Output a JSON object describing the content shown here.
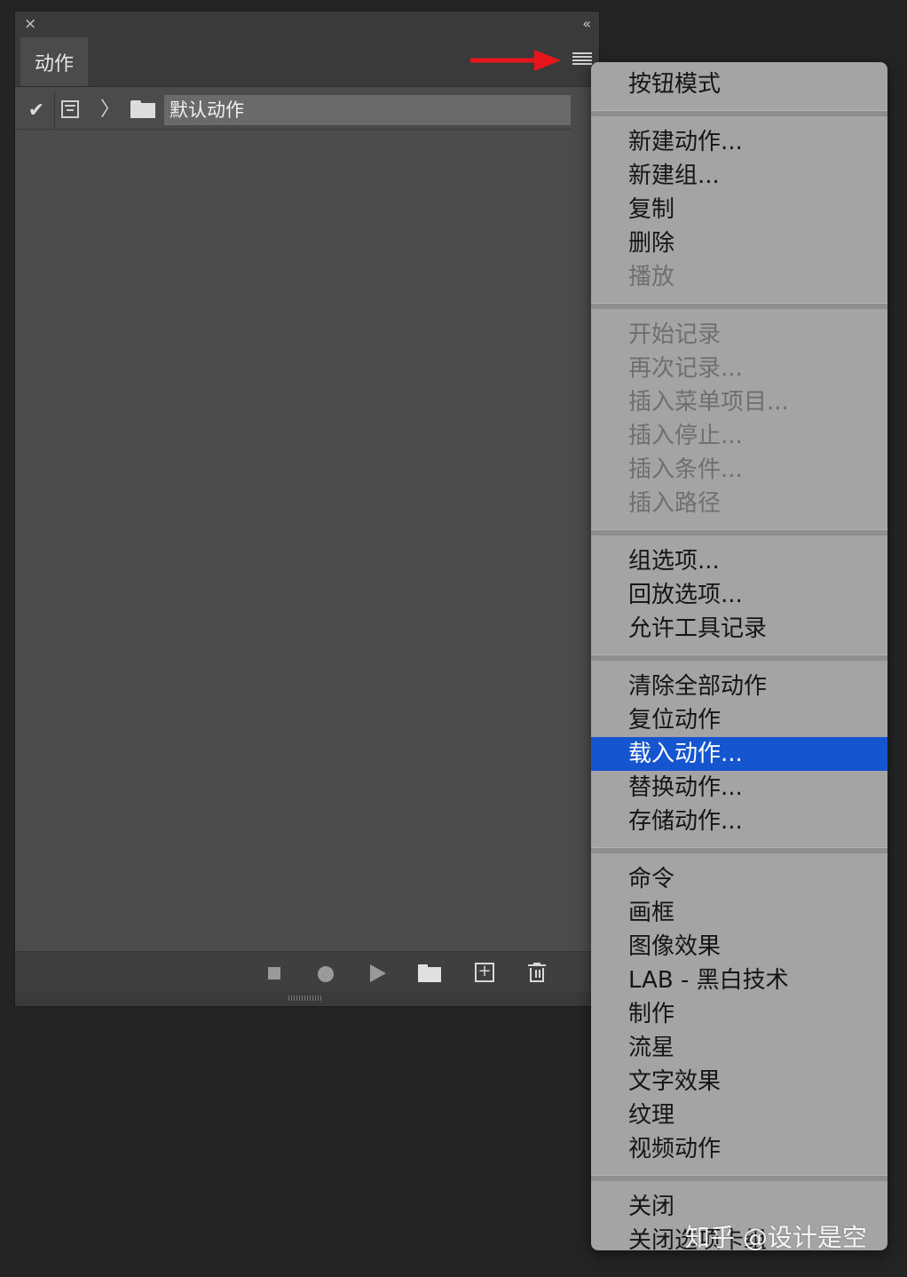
{
  "panel": {
    "tab_label": "动作",
    "close_icon": "×",
    "collapse_icon": "‹‹",
    "set": {
      "check": "✔",
      "chevron": "〉",
      "name": "默认动作"
    },
    "footer_icons": [
      "stop-icon",
      "record-icon",
      "play-icon",
      "new-set-icon",
      "new-action-icon",
      "trash-icon"
    ],
    "new_action_glyph": "+"
  },
  "arrow_color": "#e8151b",
  "menu": {
    "selected_color": "#1555d0",
    "groups": [
      {
        "items": [
          {
            "label": "按钮模式"
          }
        ]
      },
      {
        "items": [
          {
            "label": "新建动作..."
          },
          {
            "label": "新建组..."
          },
          {
            "label": "复制"
          },
          {
            "label": "删除"
          },
          {
            "label": "播放",
            "disabled": true
          }
        ]
      },
      {
        "items": [
          {
            "label": "开始记录",
            "disabled": true
          },
          {
            "label": "再次记录...",
            "disabled": true
          },
          {
            "label": "插入菜单项目...",
            "disabled": true
          },
          {
            "label": "插入停止...",
            "disabled": true
          },
          {
            "label": "插入条件...",
            "disabled": true
          },
          {
            "label": "插入路径",
            "disabled": true
          }
        ]
      },
      {
        "items": [
          {
            "label": "组选项..."
          },
          {
            "label": "回放选项..."
          },
          {
            "label": "允许工具记录"
          }
        ]
      },
      {
        "items": [
          {
            "label": "清除全部动作"
          },
          {
            "label": "复位动作"
          },
          {
            "label": "载入动作...",
            "selected": true
          },
          {
            "label": "替换动作..."
          },
          {
            "label": "存储动作..."
          }
        ]
      },
      {
        "items": [
          {
            "label": "命令"
          },
          {
            "label": "画框"
          },
          {
            "label": "图像效果"
          },
          {
            "label": "LAB - 黑白技术"
          },
          {
            "label": "制作"
          },
          {
            "label": "流星"
          },
          {
            "label": "文字效果"
          },
          {
            "label": "纹理"
          },
          {
            "label": "视频动作"
          }
        ]
      },
      {
        "items": [
          {
            "label": "关闭"
          },
          {
            "label": "关闭选项卡组"
          }
        ]
      }
    ]
  },
  "watermark": "知乎 @设计是空"
}
